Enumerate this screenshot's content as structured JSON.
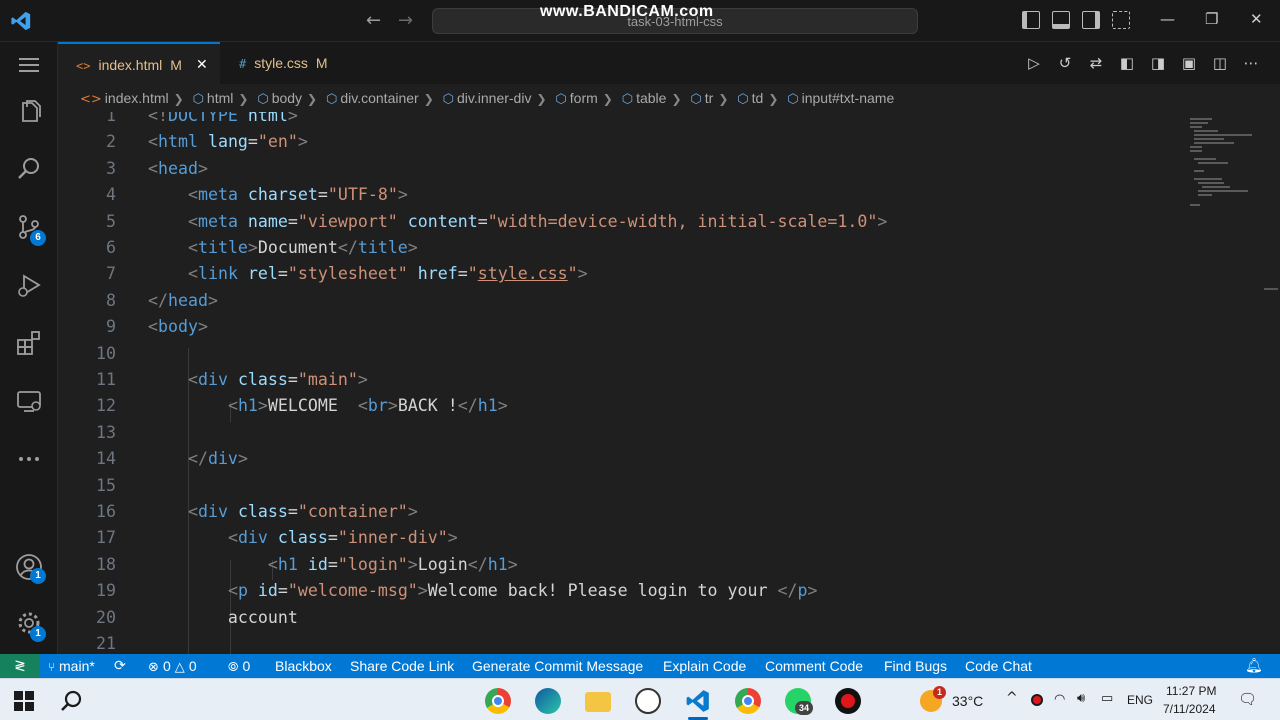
{
  "window": {
    "command_center": "task-03-html-css",
    "watermark": "www.BANDICAM.com"
  },
  "activity_bar": {
    "source_control_badge": "6",
    "accounts_badge": "1",
    "manage_badge": "1"
  },
  "tabs": [
    {
      "icon_text": "<>",
      "label": "index.html",
      "status": "M",
      "close": "✕"
    },
    {
      "icon_text": "#",
      "label": "style.css",
      "status": "M"
    }
  ],
  "breadcrumb": [
    "index.html",
    "html",
    "body",
    "div.container",
    "div.inner-div",
    "form",
    "table",
    "tr",
    "td",
    "input#txt-name"
  ],
  "code_lines": [
    {
      "n": "1",
      "tokens": [
        [
          "b",
          "<!"
        ],
        [
          "t",
          "DOCTYPE"
        ],
        [
          "a",
          " html"
        ],
        [
          "b",
          ">"
        ]
      ]
    },
    {
      "n": "2",
      "tokens": [
        [
          "b",
          "<"
        ],
        [
          "t",
          "html"
        ],
        [
          "a",
          " lang"
        ],
        [
          "x",
          "="
        ],
        [
          "s",
          "\"en\""
        ],
        [
          "b",
          ">"
        ]
      ]
    },
    {
      "n": "3",
      "tokens": [
        [
          "b",
          "<"
        ],
        [
          "t",
          "head"
        ],
        [
          "b",
          ">"
        ]
      ]
    },
    {
      "n": "4",
      "tokens": [
        [
          "x",
          "    "
        ],
        [
          "b",
          "<"
        ],
        [
          "t",
          "meta"
        ],
        [
          "a",
          " charset"
        ],
        [
          "x",
          "="
        ],
        [
          "s",
          "\"UTF-8\""
        ],
        [
          "b",
          ">"
        ]
      ]
    },
    {
      "n": "5",
      "tokens": [
        [
          "x",
          "    "
        ],
        [
          "b",
          "<"
        ],
        [
          "t",
          "meta"
        ],
        [
          "a",
          " name"
        ],
        [
          "x",
          "="
        ],
        [
          "s",
          "\"viewport\""
        ],
        [
          "a",
          " content"
        ],
        [
          "x",
          "="
        ],
        [
          "s",
          "\"width=device-width, initial-scale=1.0\""
        ],
        [
          "b",
          ">"
        ]
      ]
    },
    {
      "n": "6",
      "tokens": [
        [
          "x",
          "    "
        ],
        [
          "b",
          "<"
        ],
        [
          "t",
          "title"
        ],
        [
          "b",
          ">"
        ],
        [
          "x",
          "Document"
        ],
        [
          "b",
          "</"
        ],
        [
          "t",
          "title"
        ],
        [
          "b",
          ">"
        ]
      ]
    },
    {
      "n": "7",
      "tokens": [
        [
          "x",
          "    "
        ],
        [
          "b",
          "<"
        ],
        [
          "t",
          "link"
        ],
        [
          "a",
          " rel"
        ],
        [
          "x",
          "="
        ],
        [
          "s",
          "\"stylesheet\""
        ],
        [
          "a",
          " href"
        ],
        [
          "x",
          "="
        ],
        [
          "s",
          "\""
        ],
        [
          "u",
          "style.css"
        ],
        [
          "s",
          "\""
        ],
        [
          "b",
          ">"
        ]
      ]
    },
    {
      "n": "8",
      "tokens": [
        [
          "b",
          "</"
        ],
        [
          "t",
          "head"
        ],
        [
          "b",
          ">"
        ]
      ]
    },
    {
      "n": "9",
      "tokens": [
        [
          "b",
          "<"
        ],
        [
          "t",
          "body"
        ],
        [
          "b",
          ">"
        ]
      ]
    },
    {
      "n": "10",
      "tokens": []
    },
    {
      "n": "11",
      "tokens": [
        [
          "x",
          "    "
        ],
        [
          "b",
          "<"
        ],
        [
          "t",
          "div"
        ],
        [
          "a",
          " class"
        ],
        [
          "x",
          "="
        ],
        [
          "s",
          "\"main\""
        ],
        [
          "b",
          ">"
        ]
      ]
    },
    {
      "n": "12",
      "tokens": [
        [
          "x",
          "        "
        ],
        [
          "b",
          "<"
        ],
        [
          "t",
          "h1"
        ],
        [
          "b",
          ">"
        ],
        [
          "x",
          "WELCOME  "
        ],
        [
          "b",
          "<"
        ],
        [
          "t",
          "br"
        ],
        [
          "b",
          ">"
        ],
        [
          "x",
          "BACK !"
        ],
        [
          "b",
          "</"
        ],
        [
          "t",
          "h1"
        ],
        [
          "b",
          ">"
        ]
      ]
    },
    {
      "n": "13",
      "tokens": []
    },
    {
      "n": "14",
      "tokens": [
        [
          "x",
          "    "
        ],
        [
          "b",
          "</"
        ],
        [
          "t",
          "div"
        ],
        [
          "b",
          ">"
        ]
      ]
    },
    {
      "n": "15",
      "tokens": []
    },
    {
      "n": "16",
      "tokens": [
        [
          "x",
          "    "
        ],
        [
          "b",
          "<"
        ],
        [
          "t",
          "div"
        ],
        [
          "a",
          " class"
        ],
        [
          "x",
          "="
        ],
        [
          "s",
          "\"container\""
        ],
        [
          "b",
          ">"
        ]
      ]
    },
    {
      "n": "17",
      "tokens": [
        [
          "x",
          "        "
        ],
        [
          "b",
          "<"
        ],
        [
          "t",
          "div"
        ],
        [
          "a",
          " class"
        ],
        [
          "x",
          "="
        ],
        [
          "s",
          "\"inner-div\""
        ],
        [
          "b",
          ">"
        ]
      ]
    },
    {
      "n": "18",
      "tokens": [
        [
          "x",
          "            "
        ],
        [
          "b",
          "<"
        ],
        [
          "t",
          "h1"
        ],
        [
          "a",
          " id"
        ],
        [
          "x",
          "="
        ],
        [
          "s",
          "\"login\""
        ],
        [
          "b",
          ">"
        ],
        [
          "x",
          "Login"
        ],
        [
          "b",
          "</"
        ],
        [
          "t",
          "h1"
        ],
        [
          "b",
          ">"
        ]
      ]
    },
    {
      "n": "19",
      "tokens": [
        [
          "x",
          "        "
        ],
        [
          "b",
          "<"
        ],
        [
          "t",
          "p"
        ],
        [
          "a",
          " id"
        ],
        [
          "x",
          "="
        ],
        [
          "s",
          "\"welcome-msg\""
        ],
        [
          "b",
          ">"
        ],
        [
          "x",
          "Welcome back! Please login to your "
        ],
        [
          "b",
          "</"
        ],
        [
          "t",
          "p"
        ],
        [
          "b",
          ">"
        ]
      ]
    },
    {
      "n": "20",
      "tokens": [
        [
          "x",
          "        account"
        ]
      ]
    },
    {
      "n": "21",
      "tokens": []
    }
  ],
  "status_bar": {
    "branch": "main*",
    "errors": "0",
    "warnings": "0",
    "ports": "0",
    "items": [
      "Blackbox",
      "Share Code Link",
      "Generate Commit Message",
      "Explain Code",
      "Comment Code",
      "Find Bugs",
      "Code Chat"
    ]
  },
  "taskbar": {
    "weather_badge": "1",
    "temperature": "33°C",
    "language": "ENG",
    "time": "11:27 PM",
    "date": "7/11/2024",
    "whatsapp_badge": "34"
  },
  "colors": {
    "accent": "#0078d4",
    "tag": "#569cd6",
    "attribute": "#9cdcfe",
    "string": "#ce9178",
    "remote_indicator": "#16825d"
  }
}
